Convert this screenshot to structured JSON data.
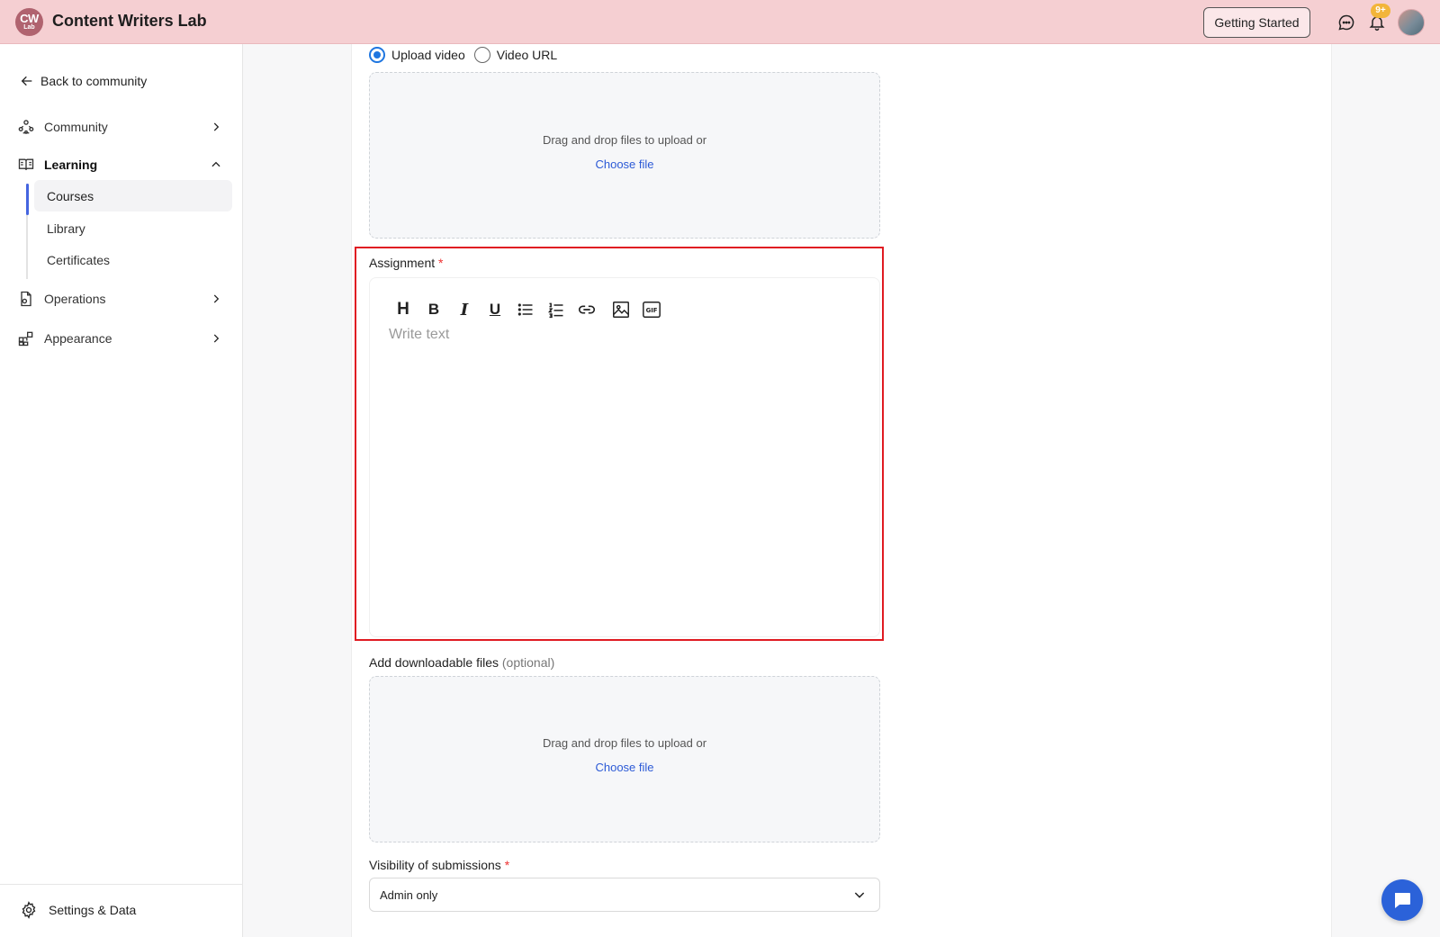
{
  "header": {
    "logo_line1": "CW",
    "logo_line2": "Lab",
    "brand": "Content Writers Lab",
    "getting_started": "Getting Started",
    "notification_count": "9+"
  },
  "sidebar": {
    "back_label": "Back to community",
    "items": [
      {
        "label": "Community",
        "icon": "community-icon",
        "expanded": false
      },
      {
        "label": "Learning",
        "icon": "book-icon",
        "expanded": true
      },
      {
        "label": "Operations",
        "icon": "document-icon",
        "expanded": false
      },
      {
        "label": "Appearance",
        "icon": "layout-icon",
        "expanded": false
      }
    ],
    "learning_sub": [
      {
        "label": "Courses",
        "active": true
      },
      {
        "label": "Library",
        "active": false
      },
      {
        "label": "Certificates",
        "active": false
      }
    ],
    "settings_label": "Settings & Data"
  },
  "main": {
    "video_options": [
      {
        "label": "Upload video",
        "selected": true
      },
      {
        "label": "Video URL",
        "selected": false
      }
    ],
    "video_dropzone": {
      "text": "Drag and drop files to upload or",
      "link": "Choose file"
    },
    "assignment": {
      "label": "Assignment",
      "required_mark": "*",
      "toolbar": [
        "heading-icon",
        "bold-icon",
        "italic-icon",
        "underline-icon",
        "bullet-list-icon",
        "numbered-list-icon",
        "link-icon",
        "image-icon",
        "gif-icon"
      ],
      "toolbar_text": {
        "heading": "H",
        "bold": "B",
        "italic": "I",
        "underline": "U"
      },
      "placeholder": "Write text"
    },
    "downloads": {
      "label": "Add downloadable files",
      "optional": "(optional)",
      "text": "Drag and drop files to upload or",
      "link": "Choose file"
    },
    "visibility": {
      "label": "Visibility of submissions",
      "required_mark": "*",
      "value": "Admin only"
    }
  },
  "colors": {
    "header_bg": "#f5cfd2",
    "accent": "#4565e0",
    "link": "#2c5ad6",
    "highlight_box": "#e01b22",
    "fab": "#2b62d9"
  }
}
